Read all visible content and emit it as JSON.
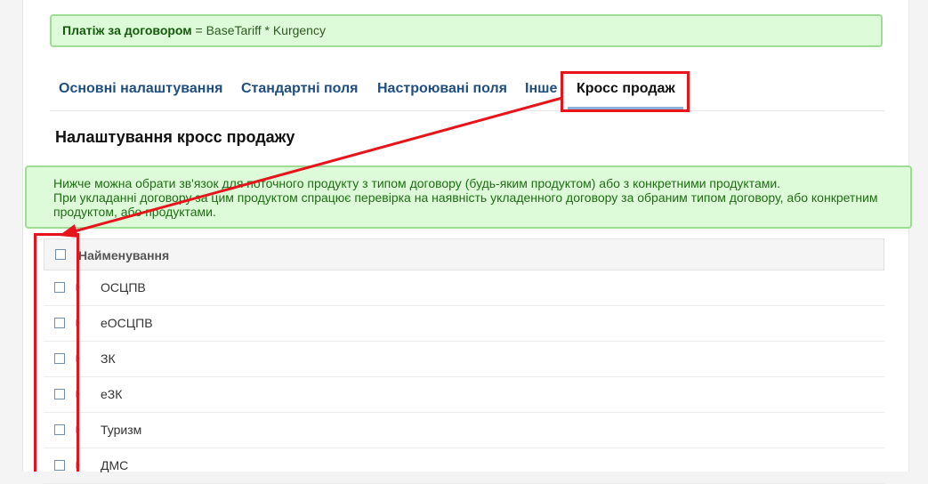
{
  "formula": {
    "label": "Платіж за договором",
    "expression": "= BaseTariff * Kurgency"
  },
  "tabs": [
    {
      "label": "Основні налаштування"
    },
    {
      "label": "Стандартні поля"
    },
    {
      "label": "Настроювані поля"
    },
    {
      "label": "Інше"
    },
    {
      "label": "Кросс продаж"
    }
  ],
  "active_tab": "Кросс продаж",
  "section_title": "Налаштування кросс продажу",
  "info": {
    "line1": "Нижче можна обрати зв'язок для поточного продукту з типом договору (будь-яким продуктом) або з конкретними продуктами.",
    "line2": "При укладанні договору за цим продуктом спрацює перевірка на наявність укладенного договору за обраним типом договору, або конкретним",
    "line3": "продуктом, або продуктами."
  },
  "table": {
    "header": "Найменування",
    "rows": [
      {
        "name": "ОСЦПВ"
      },
      {
        "name": "еОСЦПВ"
      },
      {
        "name": "ЗК"
      },
      {
        "name": "еЗК"
      },
      {
        "name": "Туризм"
      },
      {
        "name": "ДМС"
      }
    ]
  },
  "colors": {
    "highlight": "#e8141c",
    "info_bg": "#ddfbd8",
    "tab_link": "#1f4f82"
  }
}
